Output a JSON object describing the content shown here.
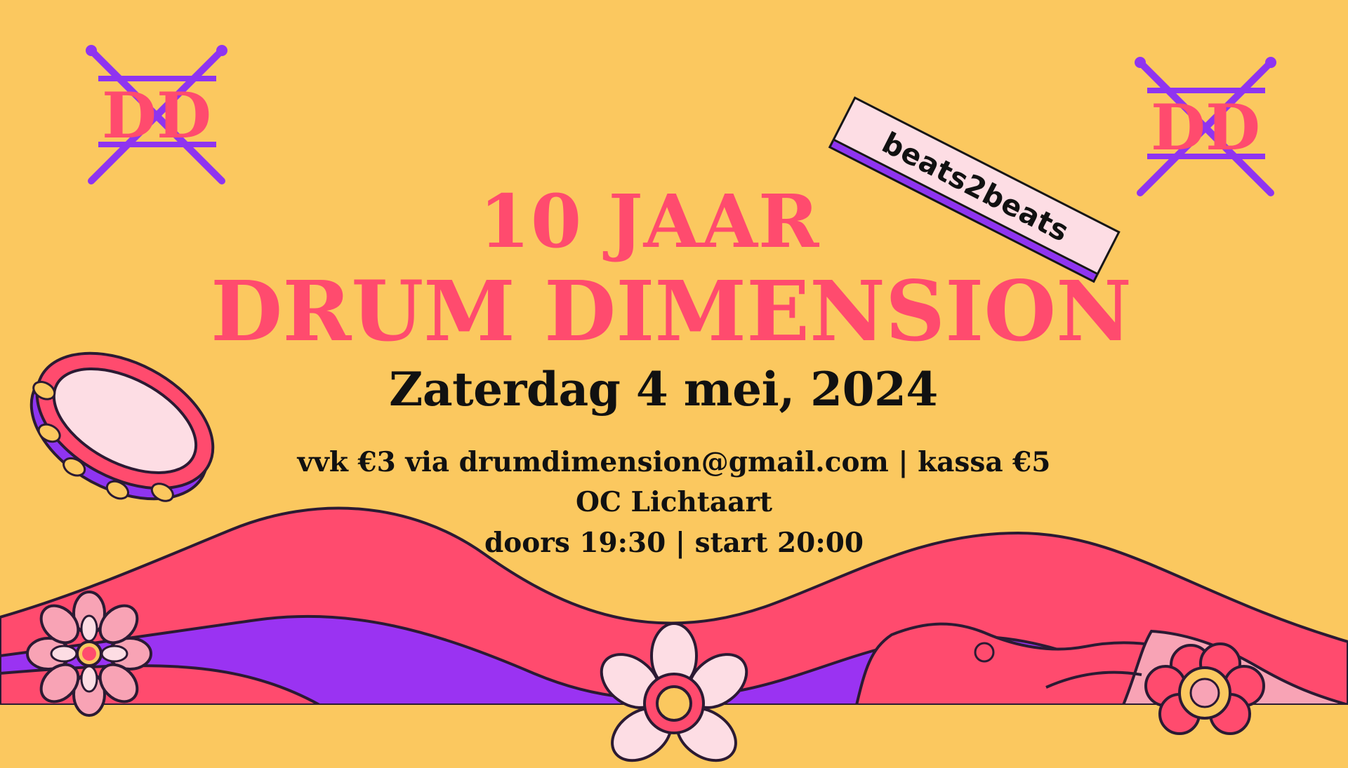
{
  "colors": {
    "background": "#FBC85F",
    "accent_pink": "#FF4B6E",
    "accent_purple": "#8F34F0",
    "accent_blush": "#FDDDE4",
    "text_dark": "#111111"
  },
  "logos": {
    "left": "DD",
    "right": "DD"
  },
  "tag": {
    "label": "beats2beats"
  },
  "headline": {
    "line1": "10 JAAR",
    "line2": "DRUM DIMENSION"
  },
  "date": "Zaterdag 4 mei, 2024",
  "details": {
    "line1": "vvk €3 via drumdimension@gmail.com | kassa €5",
    "line2": "OC Lichtaart",
    "line3": "doors 19:30 | start 20:00"
  },
  "icons": [
    "drumsticks-icon",
    "tambourine-icon",
    "flower-icon",
    "wave-icon"
  ]
}
